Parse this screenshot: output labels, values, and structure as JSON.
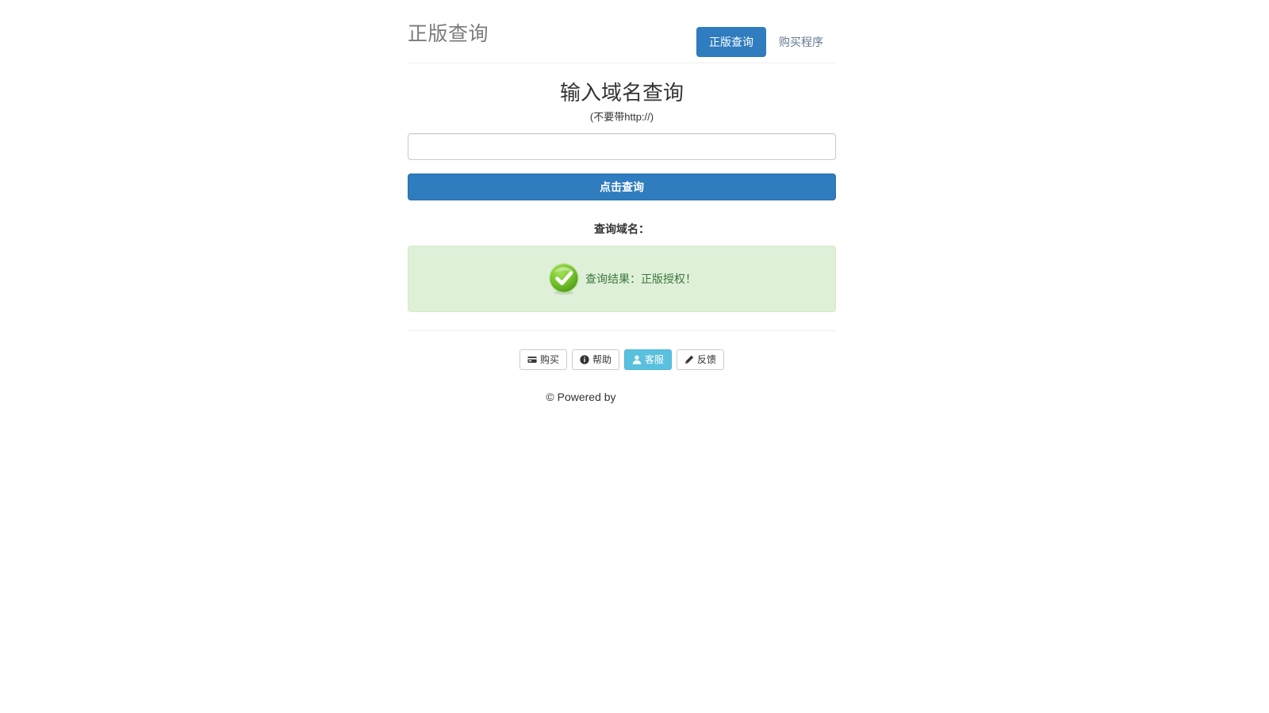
{
  "header": {
    "brand": "正版查询",
    "nav": [
      {
        "label": "正版查询",
        "active": true
      },
      {
        "label": "购买程序",
        "active": false
      }
    ]
  },
  "main": {
    "title": "输入域名查询",
    "subtitle": "(不要带http://)",
    "input": {
      "value": "",
      "placeholder": ""
    },
    "submit_label": "点击查询",
    "query_label": "查询域名：",
    "result": {
      "icon": "check-circle-icon",
      "text": "查询结果：正版授权！",
      "status": "success"
    }
  },
  "toolbar": {
    "buttons": [
      {
        "label": "购买",
        "icon": "credit-card-icon",
        "style": "default"
      },
      {
        "label": "帮助",
        "icon": "info-circle-icon",
        "style": "default"
      },
      {
        "label": "客服",
        "icon": "user-icon",
        "style": "info"
      },
      {
        "label": "反馈",
        "icon": "pencil-icon",
        "style": "default"
      }
    ]
  },
  "footer": {
    "text": "© Powered by"
  },
  "colors": {
    "primary": "#2f7cbf",
    "info": "#5bc0de",
    "success_bg": "#dff0d8",
    "success_border": "#d6e9c6",
    "success_text": "#3c763d",
    "brand_text": "#7b7b7b",
    "link": "#62798f"
  }
}
